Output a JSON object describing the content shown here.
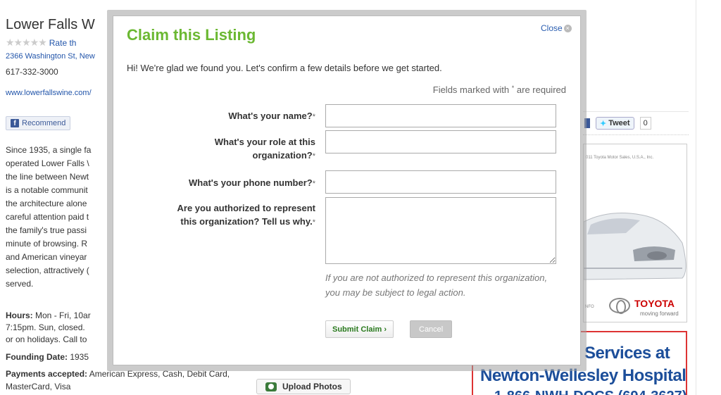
{
  "listing": {
    "name": "Lower Falls W",
    "rate_link": "Rate th",
    "address": "2366 Washington St, New",
    "phone": "617-332-3000",
    "website": "www.lowerfallswine.com/",
    "recommend_label": "Recommend",
    "rating_stars": 0,
    "description_lines": [
      "Since 1935, a single fa",
      "operated Lower Falls \\",
      "the line between Newt",
      "is a notable communit",
      "the architecture alone",
      "careful attention paid t",
      "the family's true passi",
      "minute of browsing. R",
      "and American vineyar",
      "selection, attractively (",
      "served."
    ],
    "hours_label": "Hours:",
    "hours_lines": [
      "Mon - Fri, 10ar",
      "7:15pm. Sun, closed.",
      "or on holidays. Call to"
    ],
    "founding_label": "Founding Date:",
    "founding_value": "1935",
    "payments_label": "Payments accepted:",
    "payments_value": "American Express, Cash, Debit Card, MasterCard, Visa",
    "upload_photos": "Upload Photos"
  },
  "share": {
    "tweet_label": "Tweet",
    "tweet_count": "0"
  },
  "ads": {
    "toyota_legal": "011 Toyota Motor Sales, U.S.A., Inc.",
    "toyota_info": "NFO",
    "toyota_brand": "TOYOTA",
    "toyota_tagline": "moving forward",
    "hospital_line1": "Services at",
    "hospital_line2": "Newton-Wellesley Hospital",
    "hospital_line3": "1-866-NWH-DOCS (694-3627)"
  },
  "modal": {
    "title": "Claim this Listing",
    "close_label": "Close",
    "intro": "Hi! We're glad we found you. Let's confirm a few details before we get started.",
    "required_note_pre": "Fields marked with",
    "required_note_post": "are required",
    "required_marker": "*",
    "fields": [
      {
        "label": "What's your name?",
        "value": ""
      },
      {
        "label_line1": "What's your role at this",
        "label_line2": "organization?",
        "value": ""
      },
      {
        "label": "What's your phone number?",
        "value": ""
      },
      {
        "label_line1": "Are you authorized to represent",
        "label_line2": "this organization? Tell us why.",
        "value": ""
      }
    ],
    "legal_warning": "If you are not authorized to represent this organization, you may be subject to legal action.",
    "submit_label": "Submit Claim ›",
    "cancel_label": "Cancel"
  },
  "colors": {
    "title_green": "#6bb832",
    "link_blue": "#2a5db0",
    "submit_green": "#2a7a1e",
    "toyota_red": "#cc0000",
    "hospital_blue": "#1c4e9a"
  }
}
